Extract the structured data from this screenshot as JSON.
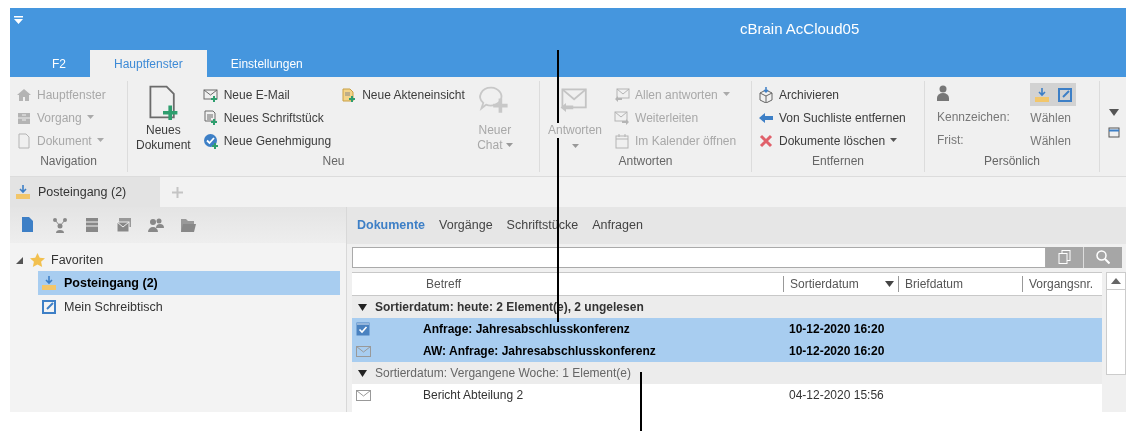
{
  "window": {
    "title": "cBrain AcCloud05"
  },
  "ribbon_tabs": [
    {
      "label": "F2",
      "selected": false
    },
    {
      "label": "Hauptfenster",
      "selected": true
    },
    {
      "label": "Einstellungen",
      "selected": false
    }
  ],
  "ribbon_groups": [
    {
      "label": "Navigation",
      "columns": [
        [
          {
            "kind": "small",
            "label": "Hauptfenster",
            "disabled": true,
            "dropdown": false
          },
          {
            "kind": "small",
            "label": "Vorgang",
            "disabled": true,
            "dropdown": true
          },
          {
            "kind": "small",
            "label": "Dokument",
            "disabled": true,
            "dropdown": true
          }
        ]
      ]
    },
    {
      "label": "Neu",
      "columns": [
        [
          {
            "kind": "large",
            "label": "Neues Dokument",
            "disabled": false,
            "dropdown": false
          }
        ],
        [
          {
            "kind": "small",
            "label": "Neue E-Mail",
            "disabled": false,
            "dropdown": false
          },
          {
            "kind": "small",
            "label": "Neues Schriftstück",
            "disabled": false,
            "dropdown": false
          },
          {
            "kind": "small",
            "label": "Neue Genehmigung",
            "disabled": false,
            "dropdown": false
          }
        ],
        [
          {
            "kind": "small",
            "label": "Neue Akteneinsicht",
            "disabled": false,
            "dropdown": false
          }
        ],
        [
          {
            "kind": "large",
            "label": "Neuer Chat",
            "disabled": true,
            "dropdown": true
          }
        ]
      ]
    },
    {
      "label": "Antworten",
      "columns": [
        [
          {
            "kind": "large",
            "label": "Antworten",
            "disabled": true,
            "dropdown": true
          }
        ],
        [
          {
            "kind": "small",
            "label": "Allen antworten",
            "disabled": true,
            "dropdown": true
          },
          {
            "kind": "small",
            "label": "Weiterleiten",
            "disabled": true,
            "dropdown": false
          },
          {
            "kind": "small",
            "label": "Im Kalender öffnen",
            "disabled": true,
            "dropdown": false
          }
        ]
      ]
    },
    {
      "label": "Entfernen",
      "columns": [
        [
          {
            "kind": "small",
            "label": "Archivieren",
            "disabled": false,
            "dropdown": false
          },
          {
            "kind": "small",
            "label": "Von Suchliste entfernen",
            "disabled": false,
            "dropdown": false
          },
          {
            "kind": "small",
            "label": "Dokumente löschen",
            "disabled": false,
            "dropdown": true
          }
        ]
      ]
    },
    {
      "label": "Persönlich",
      "toggles": [
        {
          "pressed": true
        },
        {
          "pressed": true
        }
      ],
      "fields": [
        {
          "label": "Kennzeichen:",
          "value": "Wählen"
        },
        {
          "label": "Frist:",
          "value": "Wählen"
        }
      ]
    }
  ],
  "document_tabs": [
    {
      "label": "Posteingang (2)",
      "selected": true
    }
  ],
  "sidebar": {
    "tree": [
      {
        "label": "Favoriten",
        "expanded": true,
        "children": [
          {
            "label": "Posteingang (2)",
            "selected": true
          },
          {
            "label": "Mein Schreibtisch",
            "selected": false
          }
        ]
      }
    ]
  },
  "content_tabs": [
    {
      "label": "Dokumente",
      "selected": true
    },
    {
      "label": "Vorgänge",
      "selected": false
    },
    {
      "label": "Schriftstücke",
      "selected": false
    },
    {
      "label": "Anfragen",
      "selected": false
    }
  ],
  "table": {
    "columns": [
      {
        "label": "Betreff",
        "sorted": false
      },
      {
        "label": "Sortierdatum",
        "sorted": true
      },
      {
        "label": "Briefdatum",
        "sorted": false
      },
      {
        "label": "Vorgangsnr.",
        "sorted": false
      }
    ],
    "groups": [
      {
        "label": "Sortierdatum: heute: 2 Element(e), 2 ungelesen",
        "expanded": true,
        "unread": true,
        "rows": [
          {
            "kind": "task",
            "betreff": "Anfrage: Jahresabschlusskonferenz",
            "sortierdatum": "10-12-2020 16:20",
            "unread": true,
            "selected": true
          },
          {
            "kind": "mail",
            "betreff": "AW: Anfrage: Jahresabschlusskonferenz",
            "sortierdatum": "10-12-2020 16:20",
            "unread": true,
            "selected": true
          }
        ]
      },
      {
        "label": "Sortierdatum: Vergangene Woche: 1 Element(e)",
        "expanded": true,
        "unread": false,
        "rows": [
          {
            "kind": "mail",
            "betreff": "Bericht Abteilung 2",
            "sortierdatum": "04-12-2020 15:56",
            "unread": false,
            "selected": false
          }
        ]
      }
    ]
  }
}
